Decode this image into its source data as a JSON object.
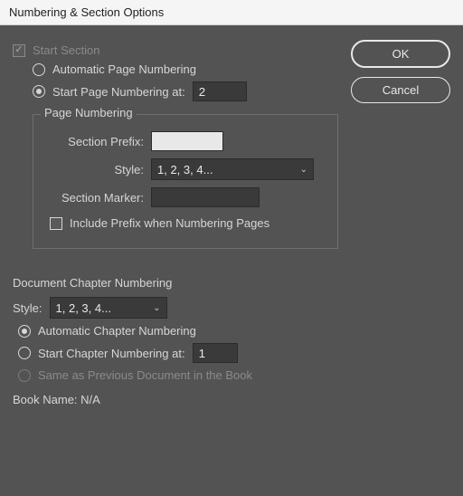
{
  "dialog": {
    "title": "Numbering & Section Options"
  },
  "buttons": {
    "ok": "OK",
    "cancel": "Cancel"
  },
  "section": {
    "start_section_label": "Start Section",
    "auto_page_label": "Automatic Page Numbering",
    "start_at_label": "Start Page Numbering at:",
    "start_at_value": "2"
  },
  "page_numbering": {
    "legend": "Page Numbering",
    "section_prefix_label": "Section Prefix:",
    "section_prefix_value": "",
    "style_label": "Style:",
    "style_value": "1, 2, 3, 4...",
    "section_marker_label": "Section Marker:",
    "section_marker_value": "",
    "include_prefix_label": "Include Prefix when Numbering Pages"
  },
  "chapter": {
    "heading": "Document Chapter Numbering",
    "style_label": "Style:",
    "style_value": "1, 2, 3, 4...",
    "auto_label": "Automatic Chapter Numbering",
    "start_at_label": "Start Chapter Numbering at:",
    "start_at_value": "1",
    "same_as_prev_label": "Same as Previous Document in the Book",
    "book_name_label": "Book Name: N/A"
  }
}
